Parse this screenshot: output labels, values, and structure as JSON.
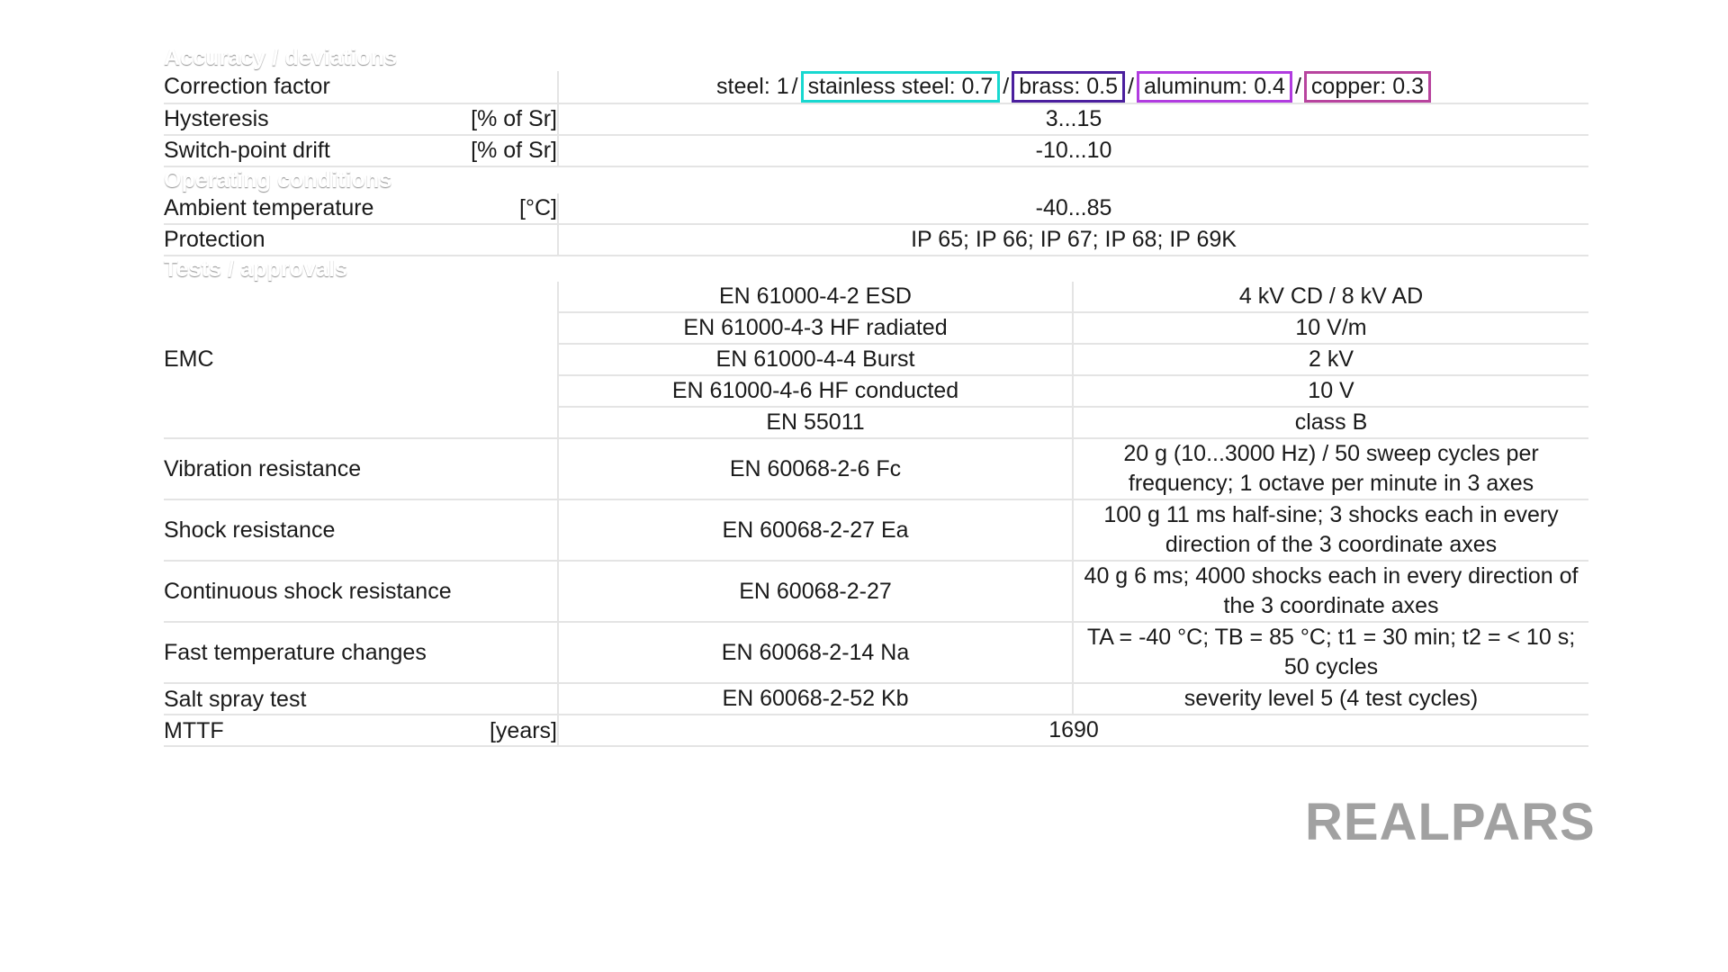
{
  "watermark": {
    "text": "REALPARS"
  },
  "colors": {
    "section_bar": "#4b4b4b",
    "row_divider": "#e4e4e4",
    "text": "#1a1a1a",
    "highlight_stainless_steel": "#18d8d0",
    "highlight_brass": "#4b1f9e",
    "highlight_aluminum": "#b13ce0",
    "highlight_copper": "#b8449e",
    "watermark_gray": "#9a9a9a"
  },
  "sections": {
    "accuracy": {
      "title": "Accuracy / deviations",
      "rows": {
        "correction_factor": {
          "label": "Correction factor",
          "unit": "",
          "value_parts": {
            "steel": "steel: 1",
            "sep1": "/",
            "stainless_steel": "stainless steel: 0.7",
            "sep2": "/",
            "brass": "brass: 0.5",
            "sep3": "/",
            "aluminum": "aluminum: 0.4",
            "sep4": "/",
            "copper": "copper: 0.3"
          },
          "value_full": "steel: 1 / stainless steel: 0.7 / brass: 0.5 / aluminum: 0.4 / copper: 0.3"
        },
        "hysteresis": {
          "label": "Hysteresis",
          "unit": "[% of Sr]",
          "value": "3...15"
        },
        "switch_point_drift": {
          "label": "Switch-point drift",
          "unit": "[% of Sr]",
          "value": "-10...10"
        }
      }
    },
    "operating": {
      "title": "Operating conditions",
      "rows": {
        "ambient_temperature": {
          "label": "Ambient temperature",
          "unit": "[°C]",
          "value": "-40...85"
        },
        "protection": {
          "label": "Protection",
          "unit": "",
          "value": "IP 65; IP 66; IP 67; IP 68; IP 69K"
        }
      }
    },
    "tests": {
      "title": "Tests / approvals",
      "emc": {
        "label": "EMC",
        "rows": [
          {
            "standard": "EN 61000-4-2 ESD",
            "value": "4 kV CD / 8 kV AD"
          },
          {
            "standard": "EN 61000-4-3 HF radiated",
            "value": "10 V/m"
          },
          {
            "standard": "EN 61000-4-4 Burst",
            "value": "2 kV"
          },
          {
            "standard": "EN 61000-4-6 HF conducted",
            "value": "10 V"
          },
          {
            "standard": "EN 55011",
            "value": "class B"
          }
        ]
      },
      "rows": [
        {
          "label": "Vibration resistance",
          "standard": "EN 60068-2-6 Fc",
          "value": "20 g (10...3000 Hz) / 50 sweep cycles per frequency; 1 octave per minute in 3 axes"
        },
        {
          "label": "Shock resistance",
          "standard": "EN 60068-2-27 Ea",
          "value": "100 g 11 ms half-sine; 3 shocks each in every direction of the 3 coordinate axes"
        },
        {
          "label": "Continuous shock resistance",
          "standard": "EN 60068-2-27",
          "value": "40 g 6 ms; 4000 shocks each in every direction of the 3 coordinate axes"
        },
        {
          "label": "Fast temperature changes",
          "standard": "EN 60068-2-14 Na",
          "value": "TA = -40 °C; TB = 85 °C; t1 = 30 min; t2 = < 10 s; 50 cycles"
        },
        {
          "label": "Salt spray test",
          "standard": "EN 60068-2-52 Kb",
          "value": "severity level 5 (4 test cycles)"
        }
      ],
      "mttf": {
        "label": "MTTF",
        "unit": "[years]",
        "value": "1690"
      }
    }
  }
}
